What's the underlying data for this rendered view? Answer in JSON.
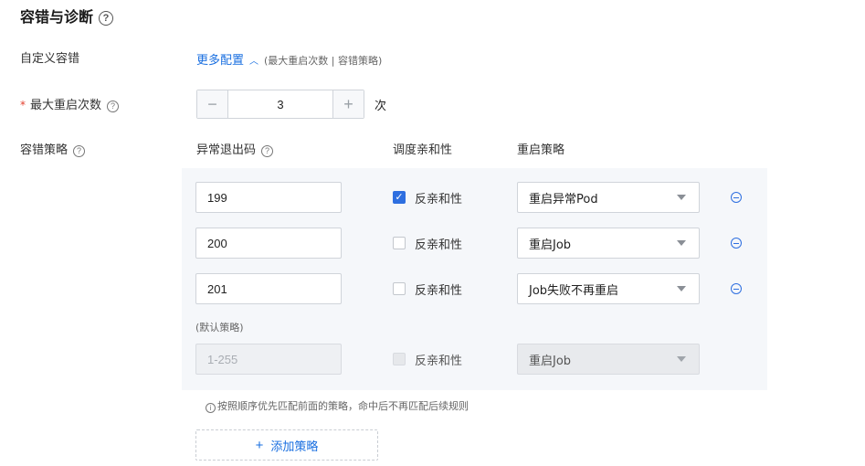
{
  "section": {
    "title": "容错与诊断",
    "help_icon": "question-circle-icon"
  },
  "custom_fault_tolerance": {
    "label": "自定义容错",
    "more_config_link": "更多配置",
    "more_config_hint": "(最大重启次数 | 容错策略)"
  },
  "max_restarts": {
    "required_mark": "*",
    "label": "最大重启次数",
    "value": "3",
    "minus": "−",
    "plus": "+",
    "unit": "次"
  },
  "policy": {
    "label": "容错策略",
    "columns": {
      "exit_code": "异常退出码",
      "affinity": "调度亲和性",
      "restart": "重启策略"
    },
    "rows": [
      {
        "exit_code": "199",
        "anti_affinity_label": "反亲和性",
        "anti_affinity_checked": true,
        "restart_policy": "重启异常Pod"
      },
      {
        "exit_code": "200",
        "anti_affinity_label": "反亲和性",
        "anti_affinity_checked": false,
        "restart_policy": "重启Job"
      },
      {
        "exit_code": "201",
        "anti_affinity_label": "反亲和性",
        "anti_affinity_checked": false,
        "restart_policy": "Job失败不再重启"
      }
    ],
    "default": {
      "label": "(默认策略)",
      "exit_code_placeholder": "1-255",
      "anti_affinity_label": "反亲和性",
      "restart_policy": "重启Job"
    },
    "hint": "按照顺序优先匹配前面的策略，命中后不再匹配后续规则",
    "add_button": "添加策略"
  },
  "colors": {
    "accent": "#1a6fe0",
    "required": "#e3412f",
    "panel_bg": "#f5f7fa"
  }
}
